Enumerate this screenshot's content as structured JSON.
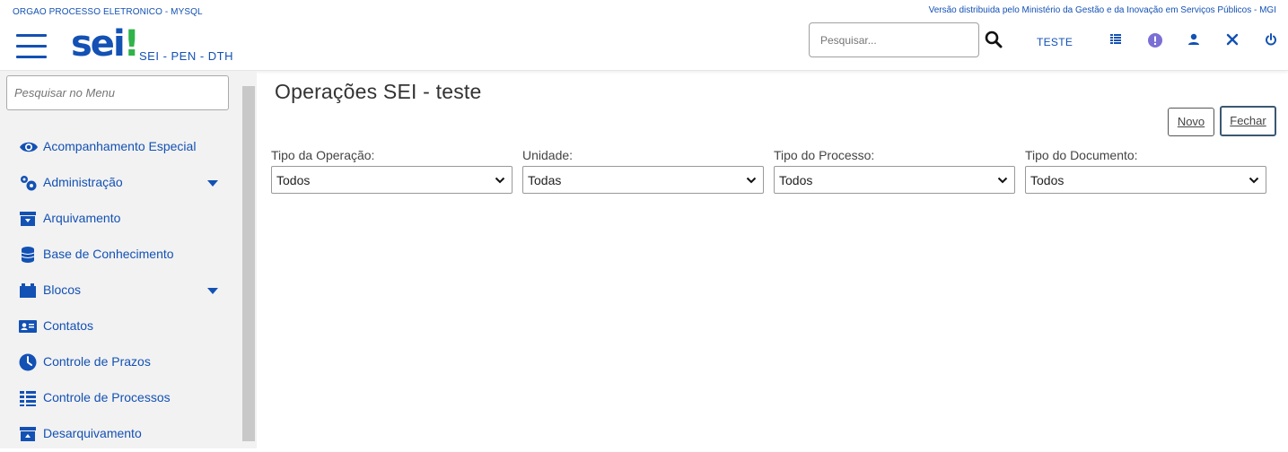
{
  "header": {
    "org_name": "ORGAO PROCESSO ELETRONICO - MYSQL",
    "version_text": "Versão distribuida pelo Ministério da Gestão e da Inovação em Serviços Públicos - MGI",
    "logo_text": "sei",
    "logo_bang": "!",
    "subtitle": "SEI - PEN - DTH",
    "search_placeholder": "Pesquisar...",
    "unit_label": "TESTE"
  },
  "sidebar": {
    "search_placeholder": "Pesquisar no Menu",
    "items": [
      {
        "label": "Acompanhamento Especial",
        "icon": "eye-icon",
        "has_submenu": false
      },
      {
        "label": "Administração",
        "icon": "gears-icon",
        "has_submenu": true
      },
      {
        "label": "Arquivamento",
        "icon": "archive-icon",
        "has_submenu": false
      },
      {
        "label": "Base de Conhecimento",
        "icon": "database-icon",
        "has_submenu": false
      },
      {
        "label": "Blocos",
        "icon": "folder-icon",
        "has_submenu": true
      },
      {
        "label": "Contatos",
        "icon": "contact-card-icon",
        "has_submenu": false
      },
      {
        "label": "Controle de Prazos",
        "icon": "clock-icon",
        "has_submenu": false
      },
      {
        "label": "Controle de Processos",
        "icon": "list-icon",
        "has_submenu": false
      },
      {
        "label": "Desarquivamento",
        "icon": "unarchive-icon",
        "has_submenu": false
      }
    ]
  },
  "main": {
    "title": "Operações SEI - teste",
    "buttons": {
      "novo": "Novo",
      "fechar": "Fechar"
    },
    "filters": [
      {
        "label": "Tipo da Operação:",
        "value": "Todos"
      },
      {
        "label": "Unidade:",
        "value": "Todas"
      },
      {
        "label": "Tipo do Processo:",
        "value": "Todos"
      },
      {
        "label": "Tipo do Documento:",
        "value": "Todos"
      }
    ]
  },
  "colors": {
    "brand_blue": "#1351b4",
    "logo_green": "#2fb34a",
    "sidebar_bg": "#f2f2f2"
  }
}
